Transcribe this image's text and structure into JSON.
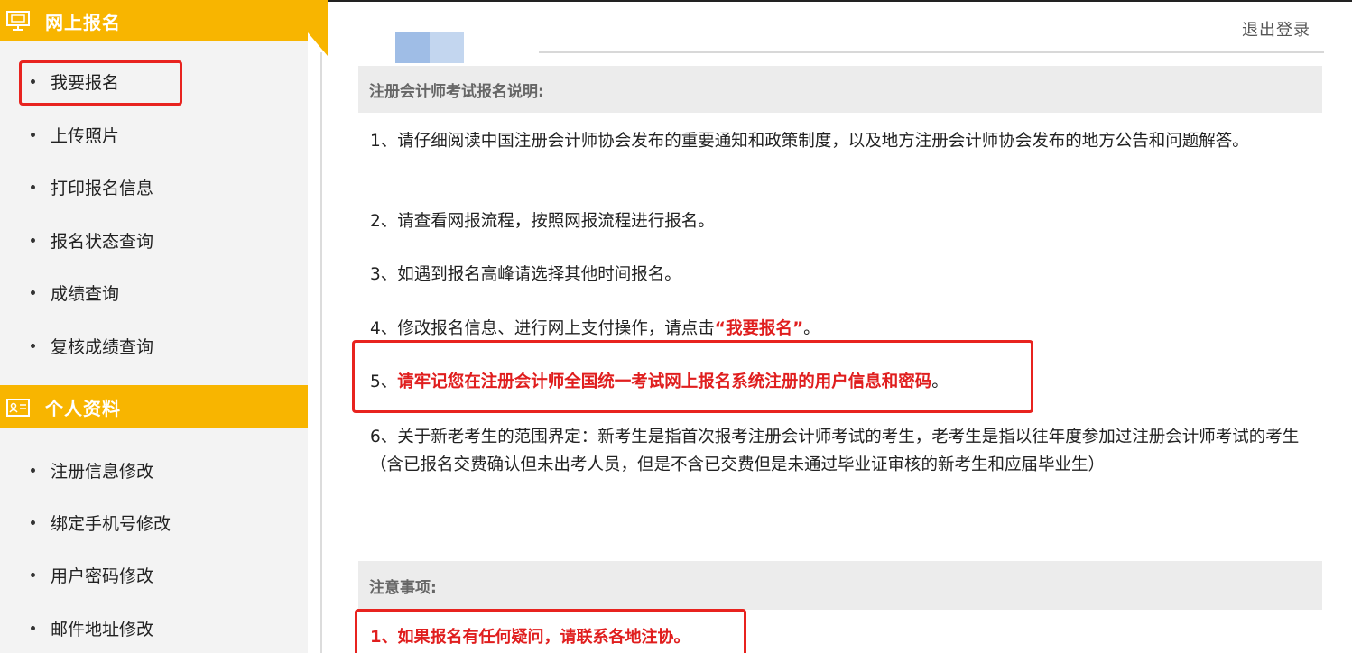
{
  "sidebar": {
    "section1": {
      "title": "网上报名",
      "icon": "monitor-icon"
    },
    "section1_items": [
      {
        "label": "我要报名"
      },
      {
        "label": "上传照片"
      },
      {
        "label": "打印报名信息"
      },
      {
        "label": "报名状态查询"
      },
      {
        "label": "成绩查询"
      },
      {
        "label": "复核成绩查询"
      }
    ],
    "section2": {
      "title": "个人资料",
      "icon": "id-card-icon"
    },
    "section2_items": [
      {
        "label": "注册信息修改"
      },
      {
        "label": "绑定手机号修改"
      },
      {
        "label": "用户密码修改"
      },
      {
        "label": "邮件地址修改"
      }
    ]
  },
  "header": {
    "logout_label": "退出登录"
  },
  "intro": {
    "title": "注册会计师考试报名说明:",
    "p1": "1、请仔细阅读中国注册会计师协会发布的重要通知和政策制度，以及地方注册会计师协会发布的地方公告和问题解答。",
    "p2": "2、请查看网报流程，按照网报流程进行报名。",
    "p3": "3、如遇到报名高峰请选择其他时间报名。",
    "p4_prefix": "4、修改报名信息、进行网上支付操作，请点击",
    "p4_link": "“我要报名”",
    "p4_suffix": "。",
    "p5_prefix": "5、",
    "p5_red": "请牢记您在注册会计师全国统一考试网上报名系统注册的用户信息和密码",
    "p5_suffix": "。",
    "p6": "6、关于新老考生的范围界定：新考生是指首次报考注册会计师考试的考生，老考生是指以往年度参加过注册会计师考试的考生（含已报名交费确认但未出考人员，但是不含已交费但是未通过毕业证审核的新考生和应届毕业生）"
  },
  "notes": {
    "title": "注意事项:",
    "n1": "1、如果报名有任何疑问，请联系各地注协。"
  },
  "colors": {
    "accent": "#f8b500",
    "highlight": "#e8231f",
    "warning_text": "#e01e1e"
  }
}
